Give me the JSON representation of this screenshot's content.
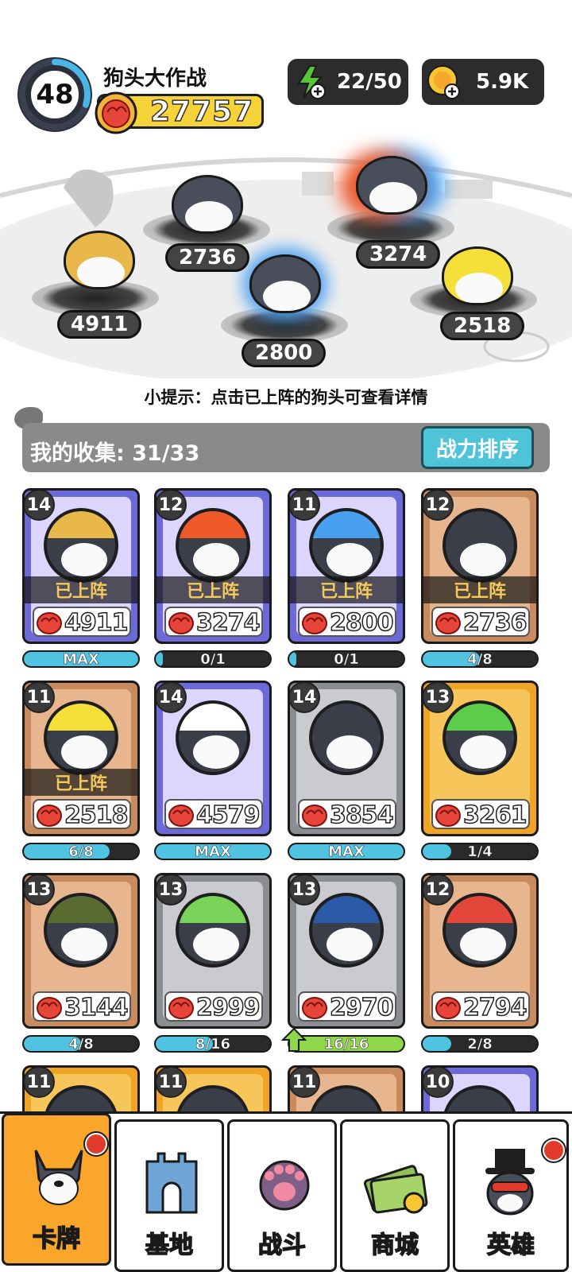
{
  "header": {
    "level": "48",
    "level_progress": 0.3,
    "title": "狗头大作战",
    "total_power": "27757",
    "energy": "22/50",
    "coins": "5.9K"
  },
  "arena": {
    "lineup": [
      {
        "id": "warrior",
        "power": "4911"
      },
      {
        "id": "baby",
        "power": "2736"
      },
      {
        "id": "blue-aura",
        "power": "2800"
      },
      {
        "id": "fire-ice",
        "power": "3274"
      },
      {
        "id": "lemon",
        "power": "2518"
      }
    ]
  },
  "tip": "小提示：点击已上阵的狗头可查看详情",
  "collection": {
    "label": "我的收集:",
    "count": "31/33",
    "sort_button": "战力排序"
  },
  "cards": [
    {
      "level": "14",
      "power": "4911",
      "status": "已上阵",
      "progress": "MAX",
      "progress_fraction": 1.0,
      "frame": "purple",
      "theme": "warrior"
    },
    {
      "level": "12",
      "power": "3274",
      "status": "已上阵",
      "progress": "0/1",
      "progress_fraction": 0.0,
      "frame": "purple",
      "theme": "fire-ice"
    },
    {
      "level": "11",
      "power": "2800",
      "status": "已上阵",
      "progress": "0/1",
      "progress_fraction": 0.0,
      "frame": "purple",
      "theme": "blue-aura"
    },
    {
      "level": "12",
      "power": "2736",
      "status": "已上阵",
      "progress": "4/8",
      "progress_fraction": 0.5,
      "frame": "bronze",
      "theme": "baby"
    },
    {
      "level": "11",
      "power": "2518",
      "status": "已上阵",
      "progress": "6/8",
      "progress_fraction": 0.75,
      "frame": "bronze",
      "theme": "lemon"
    },
    {
      "level": "14",
      "power": "4579",
      "status": "",
      "progress": "MAX",
      "progress_fraction": 1.0,
      "frame": "purple",
      "theme": "cool"
    },
    {
      "level": "14",
      "power": "3854",
      "status": "",
      "progress": "MAX",
      "progress_fraction": 1.0,
      "frame": "silver",
      "theme": "plain"
    },
    {
      "level": "13",
      "power": "3261",
      "status": "",
      "progress": "1/4",
      "progress_fraction": 0.25,
      "frame": "gold",
      "theme": "dino"
    },
    {
      "level": "13",
      "power": "3144",
      "status": "",
      "progress": "4/8",
      "progress_fraction": 0.5,
      "frame": "bronze",
      "theme": "soldier"
    },
    {
      "level": "13",
      "power": "2999",
      "status": "",
      "progress": "8/16",
      "progress_fraction": 0.5,
      "frame": "silver",
      "theme": "cabbage"
    },
    {
      "level": "13",
      "power": "2970",
      "status": "",
      "progress": "16/16",
      "progress_fraction": 1.0,
      "frame": "silver",
      "theme": "laptop",
      "upgradable": true
    },
    {
      "level": "12",
      "power": "2794",
      "status": "",
      "progress": "2/8",
      "progress_fraction": 0.25,
      "frame": "bronze",
      "theme": "clown"
    },
    {
      "level": "11",
      "frame": "gold",
      "theme": "hidden"
    },
    {
      "level": "11",
      "frame": "gold",
      "theme": "hidden"
    },
    {
      "level": "11",
      "frame": "bronze",
      "theme": "hidden"
    },
    {
      "level": "10",
      "frame": "purple",
      "theme": "hidden"
    }
  ],
  "nav": [
    {
      "label": "卡牌",
      "icon": "dog-card-icon",
      "active": true,
      "badge": true
    },
    {
      "label": "基地",
      "icon": "castle-icon",
      "active": false,
      "badge": false
    },
    {
      "label": "战斗",
      "icon": "paw-icon",
      "active": false,
      "badge": false
    },
    {
      "label": "商城",
      "icon": "money-icon",
      "active": false,
      "badge": false
    },
    {
      "label": "英雄",
      "icon": "hero-dog-icon",
      "active": false,
      "badge": true
    }
  ],
  "colors": {
    "purple_frame": "#6b6ad8",
    "bronze_frame": "#c98a5e",
    "silver_frame": "#8a8d92",
    "gold_frame": "#f0a424",
    "status_text": "#f5c95a",
    "progress_blue": "#4fc3e0",
    "progress_green": "#8fd64a",
    "nav_active": "#f9a62a"
  }
}
